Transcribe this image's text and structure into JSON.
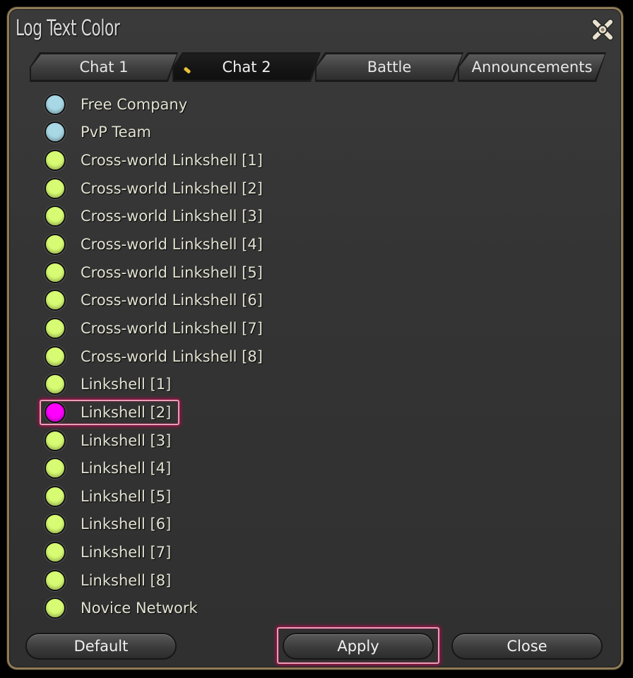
{
  "window": {
    "title": "Log Text Color"
  },
  "tabs": [
    {
      "label": "Chat 1",
      "active": false
    },
    {
      "label": "Chat 2",
      "active": true
    },
    {
      "label": "Battle",
      "active": false
    },
    {
      "label": "Announcements",
      "active": false
    }
  ],
  "channels": [
    {
      "label": "Free Company",
      "color": "#a8d8e6"
    },
    {
      "label": "PvP Team",
      "color": "#a8d8e6"
    },
    {
      "label": "Cross-world Linkshell [1]",
      "color": "#d7fc73"
    },
    {
      "label": "Cross-world Linkshell [2]",
      "color": "#d7fc73"
    },
    {
      "label": "Cross-world Linkshell [3]",
      "color": "#d7fc73"
    },
    {
      "label": "Cross-world Linkshell [4]",
      "color": "#d7fc73"
    },
    {
      "label": "Cross-world Linkshell [5]",
      "color": "#d7fc73"
    },
    {
      "label": "Cross-world Linkshell [6]",
      "color": "#d7fc73"
    },
    {
      "label": "Cross-world Linkshell [7]",
      "color": "#d7fc73"
    },
    {
      "label": "Cross-world Linkshell [8]",
      "color": "#d7fc73"
    },
    {
      "label": "Linkshell [1]",
      "color": "#d7fc73"
    },
    {
      "label": "Linkshell [2]",
      "color": "#ff00ff",
      "selected": true
    },
    {
      "label": "Linkshell [3]",
      "color": "#d7fc73"
    },
    {
      "label": "Linkshell [4]",
      "color": "#d7fc73"
    },
    {
      "label": "Linkshell [5]",
      "color": "#d7fc73"
    },
    {
      "label": "Linkshell [6]",
      "color": "#d7fc73"
    },
    {
      "label": "Linkshell [7]",
      "color": "#d7fc73"
    },
    {
      "label": "Linkshell [8]",
      "color": "#d7fc73"
    },
    {
      "label": "Novice Network",
      "color": "#d7fc73"
    }
  ],
  "buttons": {
    "default_label": "Default",
    "apply_label": "Apply",
    "close_label": "Close"
  },
  "icons": {
    "close": "close-x-icon",
    "active_tab_marker": "pencil-marker-icon"
  },
  "colors": {
    "selection_highlight": "#e7a0b6",
    "frame_gold": "#8e7b58"
  }
}
